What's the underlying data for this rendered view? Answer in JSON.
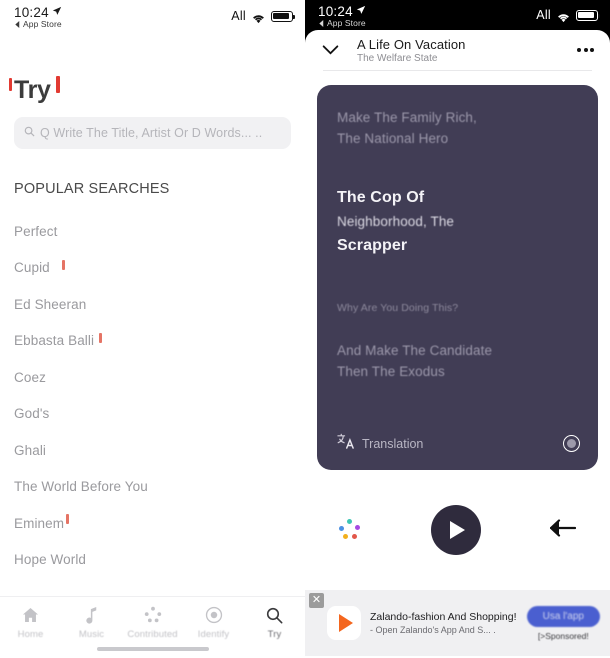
{
  "status_bar": {
    "time": "10:24",
    "back_label": "App Store",
    "carrier": "All",
    "location_icon": "location-arrow-icon",
    "wifi_icon": "wifi-icon",
    "battery_icon": "battery-icon"
  },
  "left": {
    "page_title": "Try",
    "search": {
      "placeholder": "Q Write The Title, Artist Or D Words... ..",
      "icon": "search-icon"
    },
    "popular_header": "POPULAR SEARCHES",
    "popular_items": [
      {
        "label": "Perfect",
        "mark": false
      },
      {
        "label": "Cupid",
        "mark": true
      },
      {
        "label": "Ed Sheeran",
        "mark": false
      },
      {
        "label": "Ebbasta Balli",
        "mark": true
      },
      {
        "label": "Coez",
        "mark": false
      },
      {
        "label": "God's",
        "mark": false
      },
      {
        "label": "Ghali",
        "mark": false
      },
      {
        "label": "The World Before You",
        "mark": false
      },
      {
        "label": "Eminem",
        "mark": true
      },
      {
        "label": "Hope World",
        "mark": false
      }
    ],
    "tabs": [
      {
        "label": "Home",
        "icon": "home-icon",
        "active": false
      },
      {
        "label": "Music",
        "icon": "music-note-icon",
        "active": false
      },
      {
        "label": "Contributed",
        "icon": "contributed-dots-icon",
        "active": false
      },
      {
        "label": "Identify",
        "icon": "identify-target-icon",
        "active": false
      },
      {
        "label": "Try",
        "icon": "search-icon",
        "active": true
      }
    ]
  },
  "right": {
    "now_playing": {
      "title": "A Life On Vacation",
      "artist": "The Welfare State",
      "collapse_icon": "chevron-down-icon",
      "more_icon": "more-options-icon"
    },
    "lyrics": {
      "line_1": "Make The Family Rich,",
      "line_2": "The National Hero",
      "highlight_1": "The Cop Of",
      "highlight_2": "Neighborhood, The",
      "highlight_3": "Scrapper",
      "line_3": "Why Are You Doing This?",
      "line_4": "And Make The Candidate",
      "line_5": "Then The Exodus",
      "translation_label": "Translation",
      "translation_icon": "translate-icon",
      "card_color": "#413d55"
    },
    "controls": {
      "left_icon": "shazam-dots-icon",
      "play_icon": "play-icon",
      "share_icon": "send-arrow-icon"
    },
    "ad": {
      "close_icon": "close-icon",
      "app_icon": "play-store-icon",
      "title": "Zalando-fashion And Shopping!",
      "subtitle": "- Open Zalando's App And S... .",
      "cta": "Usa l'app",
      "sponsored": "[>Sponsored!"
    }
  },
  "colors": {
    "accent_red": "#e23a32",
    "card_purple": "#413d55",
    "ad_blue": "#4a5fd0",
    "ad_orange": "#f4661e"
  }
}
